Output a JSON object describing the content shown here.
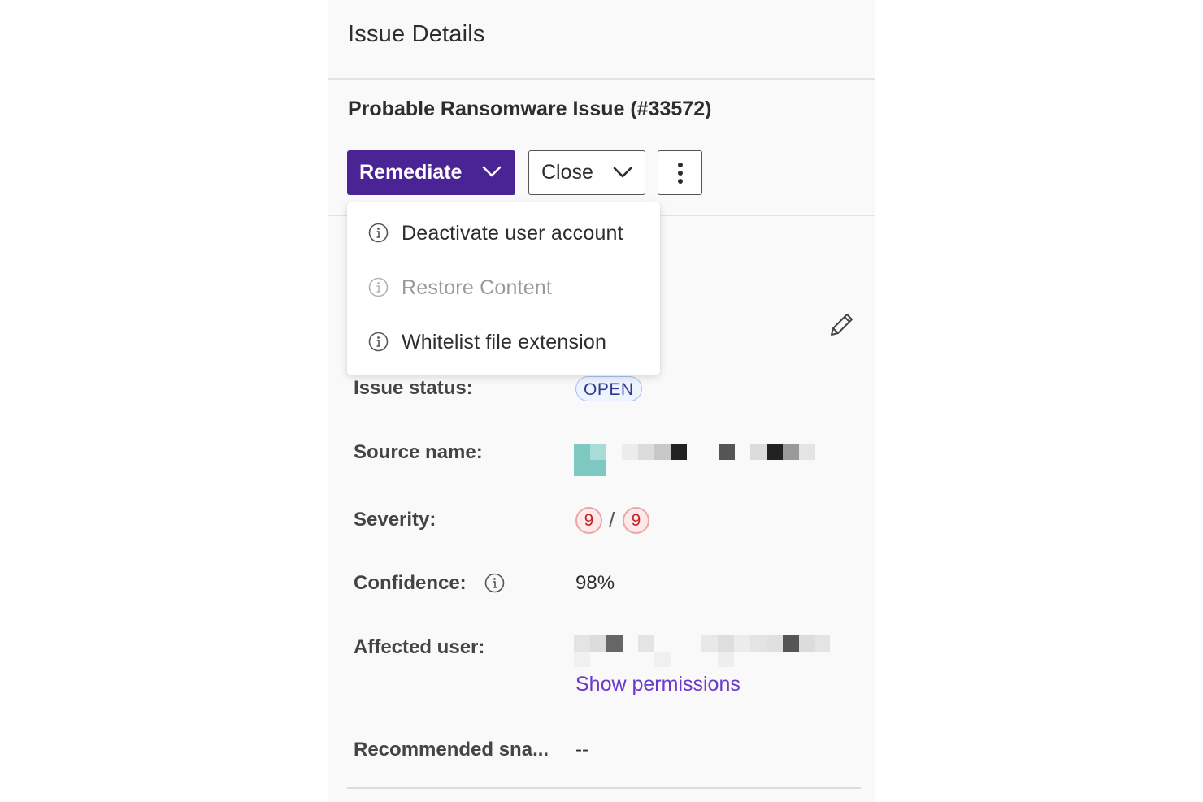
{
  "panel": {
    "title": "Issue Details"
  },
  "issue": {
    "title": "Probable Ransomware Issue (#33572)"
  },
  "actions": {
    "remediate_label": "Remediate",
    "close_label": "Close"
  },
  "remediate_menu": {
    "items": [
      {
        "label": "Deactivate user account",
        "disabled": false,
        "icon": "info-icon"
      },
      {
        "label": "Restore Content",
        "disabled": true,
        "icon": "info-icon"
      },
      {
        "label": "Whitelist file extension",
        "disabled": false,
        "icon": "info-icon"
      }
    ]
  },
  "details": {
    "status_label": "Issue status:",
    "status_value": "OPEN",
    "source_label": "Source name:",
    "severity_label": "Severity:",
    "severity_value_1": "9",
    "severity_separator": "/",
    "severity_value_2": "9",
    "confidence_label": "Confidence:",
    "confidence_value": "98%",
    "affected_user_label": "Affected user:",
    "show_permissions_label": "Show permissions",
    "recommended_label": "Recommended sna...",
    "recommended_value": "--"
  },
  "colors": {
    "primary": "#4a2394",
    "link": "#6b39cc",
    "badge_border": "#a9c0f0",
    "severity_red": "#c42323"
  }
}
